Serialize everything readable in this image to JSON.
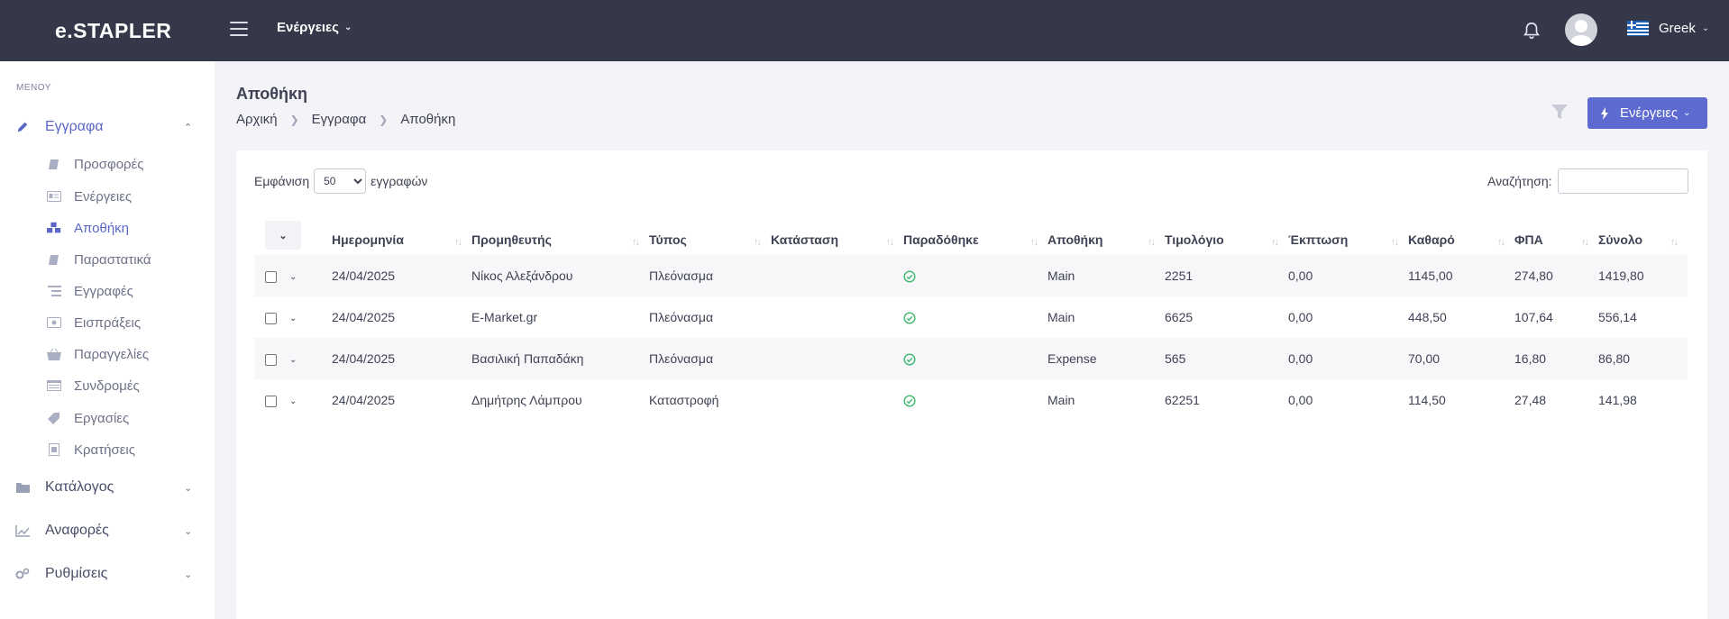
{
  "header": {
    "logo": "e.STAPLER",
    "actions_label": "Ενέργειες",
    "language": "Greek"
  },
  "sidebar": {
    "menu_label": "ΜΕΝΟΥ",
    "sections": [
      {
        "label": "Εγγραφα",
        "icon": "pencil-icon",
        "expanded": true
      },
      {
        "label": "Κατάλογος",
        "icon": "folder-icon"
      },
      {
        "label": "Αναφορές",
        "icon": "chart-line-icon"
      },
      {
        "label": "Ρυθμίσεις",
        "icon": "cogs-icon"
      }
    ],
    "items": [
      {
        "label": "Προσφορές",
        "icon": "book-icon"
      },
      {
        "label": "Ενέργειες",
        "icon": "id-card-icon"
      },
      {
        "label": "Αποθήκη",
        "icon": "cubes-icon",
        "active": true
      },
      {
        "label": "Παραστατικά",
        "icon": "book-icon"
      },
      {
        "label": "Εγγραφές",
        "icon": "list-icon"
      },
      {
        "label": "Εισπράξεις",
        "icon": "money-icon"
      },
      {
        "label": "Παραγγελίες",
        "icon": "basket-icon"
      },
      {
        "label": "Συνδρομές",
        "icon": "table-icon"
      },
      {
        "label": "Εργασίες",
        "icon": "tag-icon"
      },
      {
        "label": "Κρατήσεις",
        "icon": "badge-icon"
      }
    ]
  },
  "page": {
    "title": "Αποθήκη",
    "breadcrumb": [
      "Αρχική",
      "Εγγραφα",
      "Αποθήκη"
    ],
    "actions_button": "Ενέργειες"
  },
  "table_controls": {
    "show_prefix": "Εμφάνιση",
    "page_size": "50",
    "show_suffix": "εγγραφών",
    "search_label": "Αναζήτηση:",
    "search_value": ""
  },
  "table": {
    "columns": [
      "Ημερομηνία",
      "Προμηθευτής",
      "Τύπος",
      "Κατάσταση",
      "Παραδόθηκε",
      "Αποθήκη",
      "Τιμολόγιο",
      "Έκπτωση",
      "Καθαρό",
      "ΦΠΑ",
      "Σύνολο"
    ],
    "rows": [
      {
        "date": "24/04/2025",
        "supplier": "Νίκος Αλεξάνδρου",
        "type": "Πλεόνασμα",
        "status": "",
        "delivered": true,
        "warehouse": "Main",
        "invoice": "2251",
        "discount": "0,00",
        "net": "1145,00",
        "vat": "274,80",
        "total": "1419,80"
      },
      {
        "date": "24/04/2025",
        "supplier": "E-Market.gr",
        "type": "Πλεόνασμα",
        "status": "",
        "delivered": true,
        "warehouse": "Main",
        "invoice": "6625",
        "discount": "0,00",
        "net": "448,50",
        "vat": "107,64",
        "total": "556,14"
      },
      {
        "date": "24/04/2025",
        "supplier": "Βασιλική Παπαδάκη",
        "type": "Πλεόνασμα",
        "status": "",
        "delivered": true,
        "warehouse": "Expense",
        "invoice": "565",
        "discount": "0,00",
        "net": "70,00",
        "vat": "16,80",
        "total": "86,80"
      },
      {
        "date": "24/04/2025",
        "supplier": "Δημήτρης Λάμπρου",
        "type": "Καταστροφή",
        "status": "",
        "delivered": true,
        "warehouse": "Main",
        "invoice": "62251",
        "discount": "0,00",
        "net": "114,50",
        "vat": "27,48",
        "total": "141,98"
      }
    ]
  },
  "colors": {
    "topbar": "#343849",
    "accent": "#5d6bd1",
    "success": "#3dba6f"
  }
}
